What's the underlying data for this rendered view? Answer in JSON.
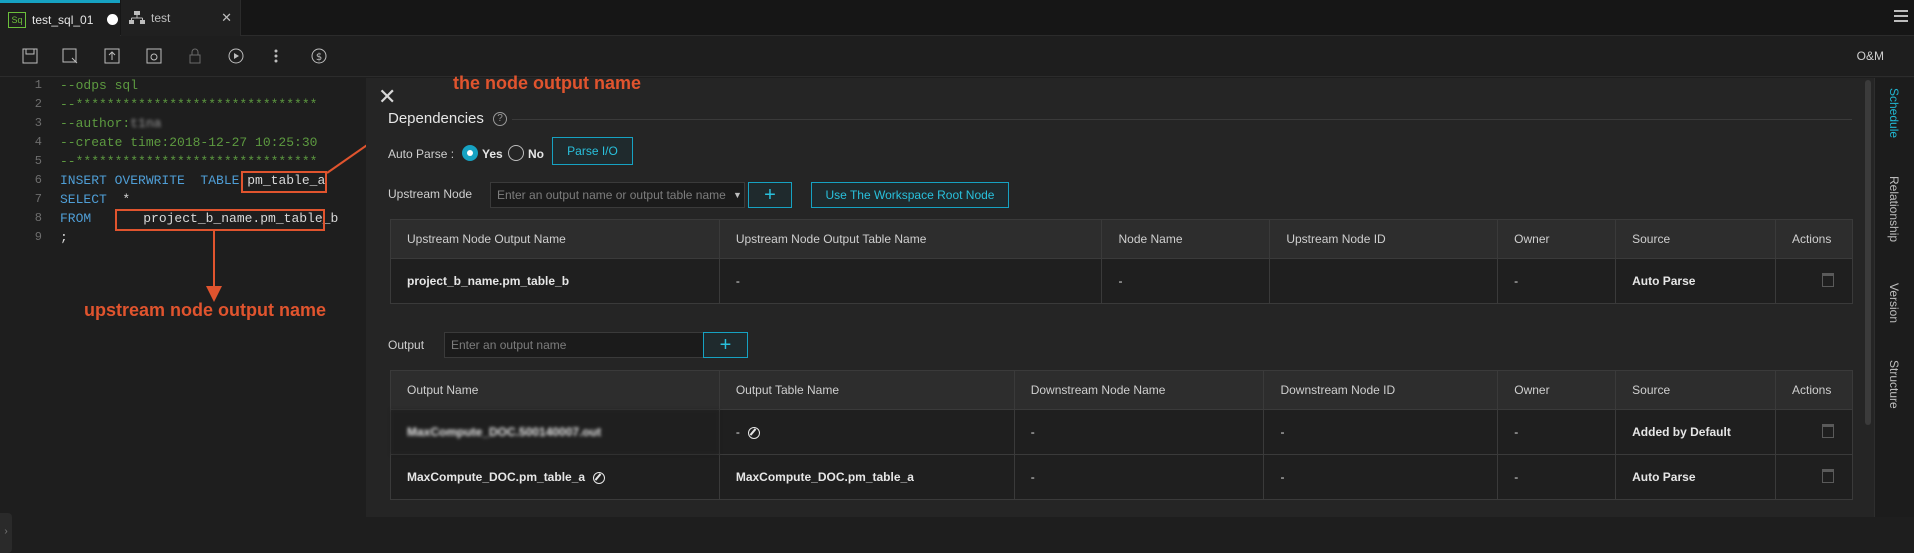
{
  "tabs": [
    {
      "label": "test_sql_01",
      "icon": "sql-icon"
    },
    {
      "label": "test",
      "icon": "workflow-icon"
    }
  ],
  "toolbar": {
    "right_label": "O&M",
    "icons": [
      "save-icon",
      "save-as-icon",
      "submit-icon",
      "unlock-icon",
      "lock-icon",
      "run-icon",
      "more-icon",
      "cost-icon"
    ]
  },
  "editor": {
    "lines": [
      {
        "n": "1",
        "text": "--odps sql"
      },
      {
        "n": "2",
        "text": "--*******************************"
      },
      {
        "n": "3",
        "text": "--author:"
      },
      {
        "n": "4",
        "text": "--create time:2018-12-27 10:25:30"
      },
      {
        "n": "5",
        "text": "--*******************************"
      },
      {
        "n": "6",
        "kw": "INSERT OVERWRITE  TABLE ",
        "ident": "pm_table_a"
      },
      {
        "n": "7",
        "kw": "SELECT",
        "rest": "  *"
      },
      {
        "n": "8",
        "kw": "FROM",
        "ident": "project_b_name.pm_table_b"
      },
      {
        "n": "9",
        "text": ";"
      }
    ],
    "author_redacted": "t1na"
  },
  "annotations": {
    "top": "the node output name",
    "bottom": "upstream node output name"
  },
  "panel": {
    "title": "Dependencies",
    "auto_parse_label": "Auto Parse :",
    "yes": "Yes",
    "no": "No",
    "parse_io": "Parse I/O",
    "upstream_label": "Upstream Node",
    "upstream_placeholder": "Enter an output name or output table name",
    "root_node_btn": "Use The Workspace Root Node",
    "upstream_headers": [
      "Upstream Node Output Name",
      "Upstream Node Output Table Name",
      "Node Name",
      "Upstream Node ID",
      "Owner",
      "Source",
      "Actions"
    ],
    "upstream_rows": [
      [
        "project_b_name.pm_table_b",
        "-",
        "-",
        "",
        "-",
        "Auto Parse"
      ]
    ],
    "output_label": "Output",
    "output_placeholder": "Enter an output name",
    "output_headers": [
      "Output Name",
      "Output Table Name",
      "Downstream Node Name",
      "Downstream Node ID",
      "Owner",
      "Source",
      "Actions"
    ],
    "output_rows": [
      [
        "MaxCompute_DOC.500140007.out",
        "-",
        "-",
        "-",
        "-",
        "Added by Default"
      ],
      [
        "MaxCompute_DOC.pm_table_a",
        "MaxCompute_DOC.pm_table_a",
        "-",
        "-",
        "-",
        "Auto Parse"
      ]
    ]
  },
  "rail": [
    "Schedule",
    "Relationship",
    "Version",
    "Structure"
  ],
  "colors": {
    "accent": "#16a2c2",
    "annotation": "#e0542e"
  }
}
